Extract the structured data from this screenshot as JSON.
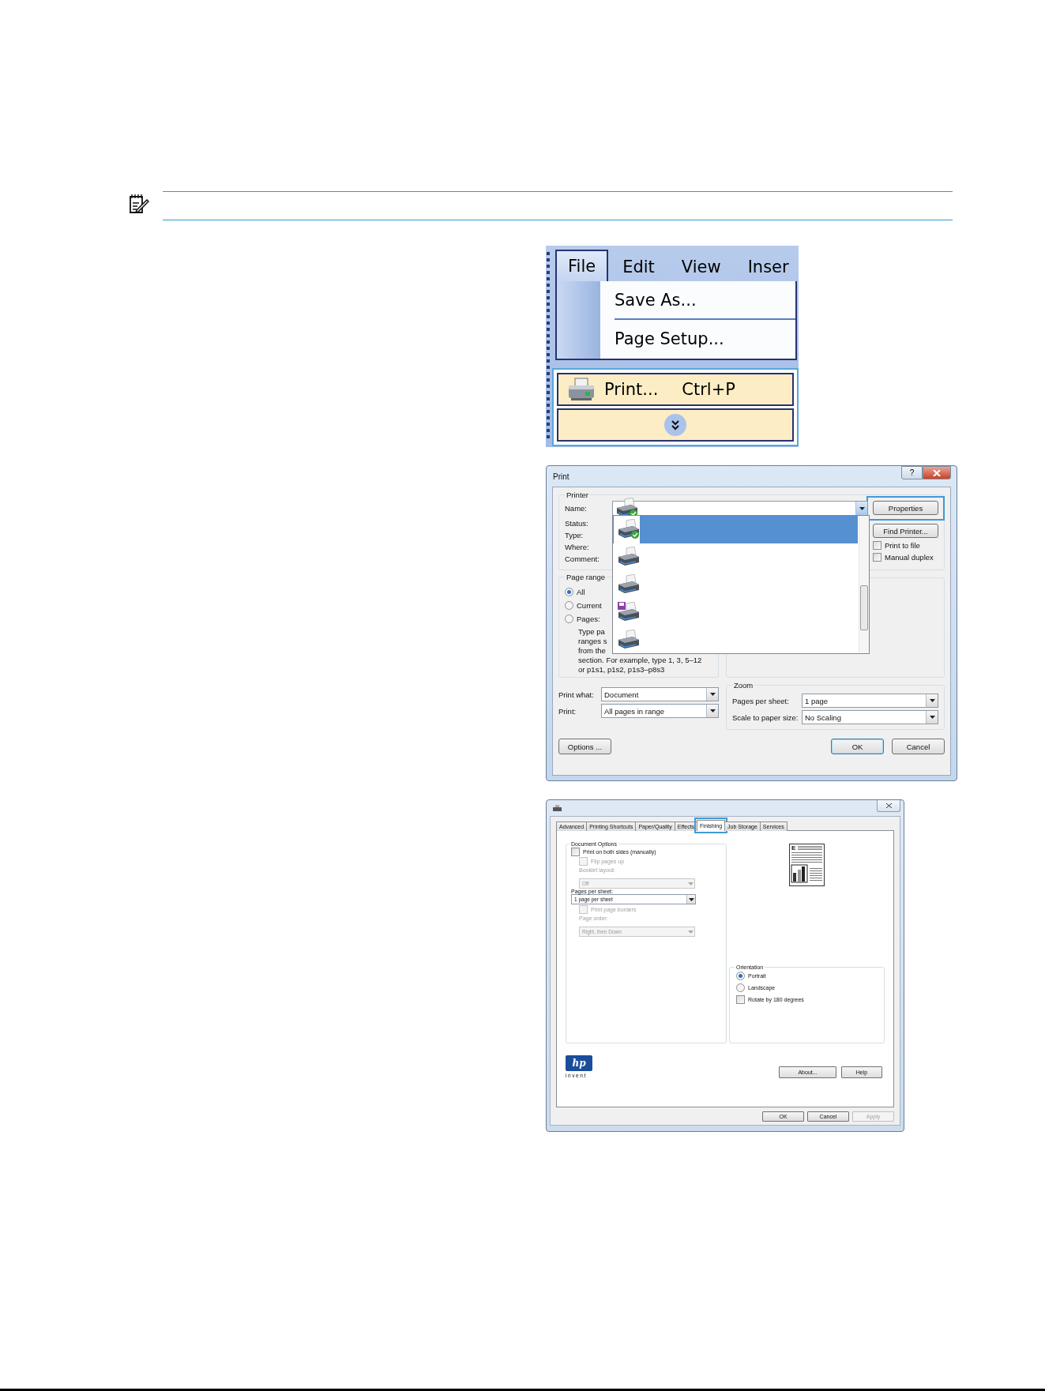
{
  "menu": {
    "tabs": [
      {
        "label": "File",
        "selected": true
      },
      {
        "label": "Edit",
        "selected": false
      },
      {
        "label": "View",
        "selected": false
      },
      {
        "label": "Inser",
        "selected": false
      }
    ],
    "items": [
      {
        "kind": "command",
        "label": "Save As...",
        "selected": false,
        "callout": false
      },
      {
        "kind": "separator",
        "callout": false
      },
      {
        "kind": "command",
        "label": "Page Setup...",
        "selected": false,
        "callout": false
      },
      {
        "kind": "iconcommand",
        "label": "Print...",
        "shortcut": "Ctrl+P",
        "selected": true,
        "callout": true
      },
      {
        "kind": "expand",
        "selected": true,
        "callout": true
      }
    ]
  },
  "print_dialog": {
    "title": "Print",
    "help_button": "?",
    "printer": {
      "legend": "Printer",
      "labels": [
        "Name:",
        "Status:",
        "Type:",
        "Where:",
        "Comment:"
      ],
      "printers": [
        {
          "kind": "printer",
          "selected": true
        },
        {
          "kind": "printer",
          "selected": false
        },
        {
          "kind": "printer",
          "selected": false
        },
        {
          "kind": "file_printer",
          "selected": false
        },
        {
          "kind": "printer",
          "selected": false
        }
      ],
      "buttons": [
        {
          "label": "Properties",
          "callout": true
        },
        {
          "label": "Find Printer...",
          "callout": false
        }
      ],
      "checkboxes": [
        {
          "label": "Print to file",
          "checked": false
        },
        {
          "label": "Manual duplex",
          "checked": false
        }
      ]
    },
    "page_range": {
      "legend": "Page range",
      "options": [
        {
          "label": "All",
          "selected": true
        },
        {
          "label": "Current",
          "selected": false
        },
        {
          "label": "Pages:",
          "selected": false
        }
      ],
      "hint_lines": [
        "Type pa",
        "ranges s",
        "from the",
        "section. For example, type 1, 3, 5–12",
        "or p1s1, p1s2, p1s3–p8s3"
      ]
    },
    "print_what": {
      "label": "Print what:",
      "value": "Document"
    },
    "print": {
      "label": "Print:",
      "value": "All pages in range"
    },
    "zoom": {
      "legend": "Zoom",
      "rows": [
        {
          "label": "Pages per sheet:",
          "value": "1 page"
        },
        {
          "label": "Scale to paper size:",
          "value": "No Scaling"
        }
      ]
    },
    "buttons": [
      {
        "label": "Options ...",
        "default": false
      },
      {
        "label": "OK",
        "default": true
      },
      {
        "label": "Cancel",
        "default": false
      }
    ]
  },
  "finishing_dialog": {
    "tabs": [
      {
        "label": "Advanced",
        "selected": false,
        "callout": false
      },
      {
        "label": "Printing Shortcuts",
        "selected": false,
        "callout": false
      },
      {
        "label": "Paper/Quality",
        "selected": false,
        "callout": false
      },
      {
        "label": "Effects",
        "selected": false,
        "callout": false
      },
      {
        "label": "Finishing",
        "selected": true,
        "callout": true
      },
      {
        "label": "Job Storage",
        "selected": false,
        "callout": false
      },
      {
        "label": "Services",
        "selected": false,
        "callout": false
      }
    ],
    "document_options": {
      "legend": "Document Options",
      "both_sides": {
        "label": "Print on both sides (manually)",
        "checked": false,
        "disabled": false
      },
      "flip": {
        "label": "Flip pages up",
        "checked": false,
        "disabled": true
      },
      "booklet": {
        "label": "Booklet layout:",
        "value": "Off",
        "disabled": true
      },
      "pages_per_sheet": {
        "label": "Pages per sheet:",
        "value": "1 page per sheet",
        "disabled": false
      },
      "borders": {
        "label": "Print page borders",
        "checked": false,
        "disabled": true
      },
      "page_order": {
        "label": "Page order:",
        "value": "Right, then Down",
        "disabled": true
      }
    },
    "preview_letter": "E",
    "orientation": {
      "legend": "Orientation",
      "options": [
        {
          "label": "Portrait",
          "selected": true
        },
        {
          "label": "Landscape",
          "selected": false
        }
      ],
      "rotate": {
        "label": "Rotate by 180 degrees",
        "checked": false
      }
    },
    "logo": {
      "text": "hp",
      "tagline": "invent"
    },
    "panel_buttons": [
      {
        "label": "About...",
        "disabled": false
      },
      {
        "label": "Help",
        "disabled": false
      }
    ],
    "buttons": [
      {
        "label": "OK",
        "disabled": false
      },
      {
        "label": "Cancel",
        "disabled": false
      },
      {
        "label": "Apply",
        "disabled": true
      }
    ]
  }
}
